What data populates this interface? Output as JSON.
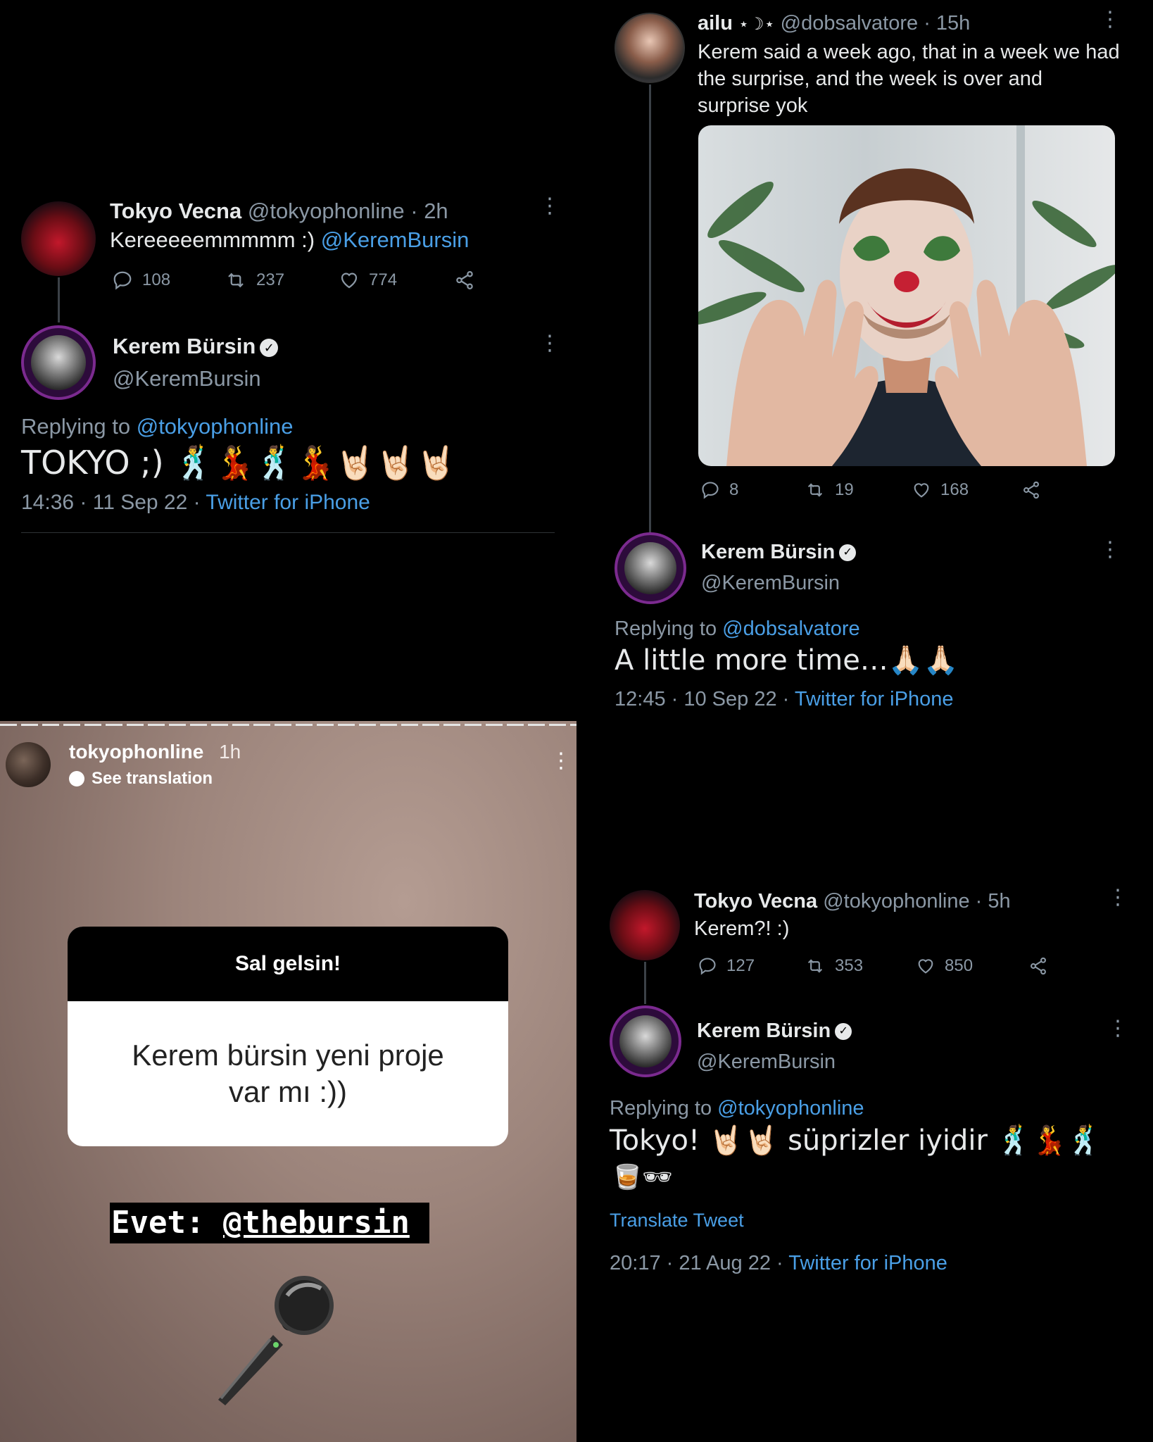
{
  "tweet_a": {
    "name": "Tokyo Vecna",
    "handle_time": "@tokyophonline · 2h",
    "text_before": "Kereeeeemmmmm :) ",
    "mention": "@KeremBursin",
    "replies": "108",
    "retweets": "237",
    "likes": "774"
  },
  "reply_a": {
    "name": "Kerem Bürsin",
    "handle": "@KeremBursin",
    "replying_label": "Replying to ",
    "replying_to": "@tokyophonline",
    "text": "TOKYO ;) 🕺💃🕺💃🤘🏻🤘🏻🤘🏻",
    "datetime": "14:36 · 11 Sep 22 · ",
    "client": "Twitter for iPhone"
  },
  "tweet_b": {
    "name": "ailu",
    "name_symbols": "⋆☽⋆",
    "handle_time": "@dobsalvatore · 15h",
    "text": "Kerem said a week ago, that in a week we had the surprise, and the week is over and surprise yok",
    "replies": "8",
    "retweets": "19",
    "likes": "168"
  },
  "reply_b": {
    "name": "Kerem Bürsin",
    "handle": "@KeremBursin",
    "replying_label": "Replying to ",
    "replying_to": "@dobsalvatore",
    "text": "A little more time…🙏🏻🙏🏻",
    "datetime": "12:45 · 10 Sep 22 · ",
    "client": "Twitter for iPhone"
  },
  "story": {
    "username": "tokyophonline",
    "time": "1h",
    "see_translation": "See translation",
    "question_title": "Sal gelsin!",
    "question_text": "Kerem bürsin yeni proje var mı :))",
    "answer_prefix": "Evet: ",
    "answer_mention": "@thebursin"
  },
  "tweet_c": {
    "name": "Tokyo Vecna",
    "handle_time": "@tokyophonline · 5h",
    "text": "Kerem?! :)",
    "replies": "127",
    "retweets": "353",
    "likes": "850"
  },
  "reply_c": {
    "name": "Kerem Bürsin",
    "handle": "@KeremBursin",
    "replying_label": "Replying to ",
    "replying_to": "@tokyophonline",
    "text_line1": "Tokyo! 🤘🏻🤘🏻 süprizler iyidir 🕺💃🕺",
    "text_line2": "🥃🕶",
    "translate": "Translate Tweet",
    "datetime": "20:17 · 21 Aug 22 · ",
    "client": "Twitter for iPhone"
  },
  "colors": {
    "background": "#000000",
    "link": "#4a9fe6",
    "muted": "#8b98a5",
    "text": "#e7e9ea"
  }
}
